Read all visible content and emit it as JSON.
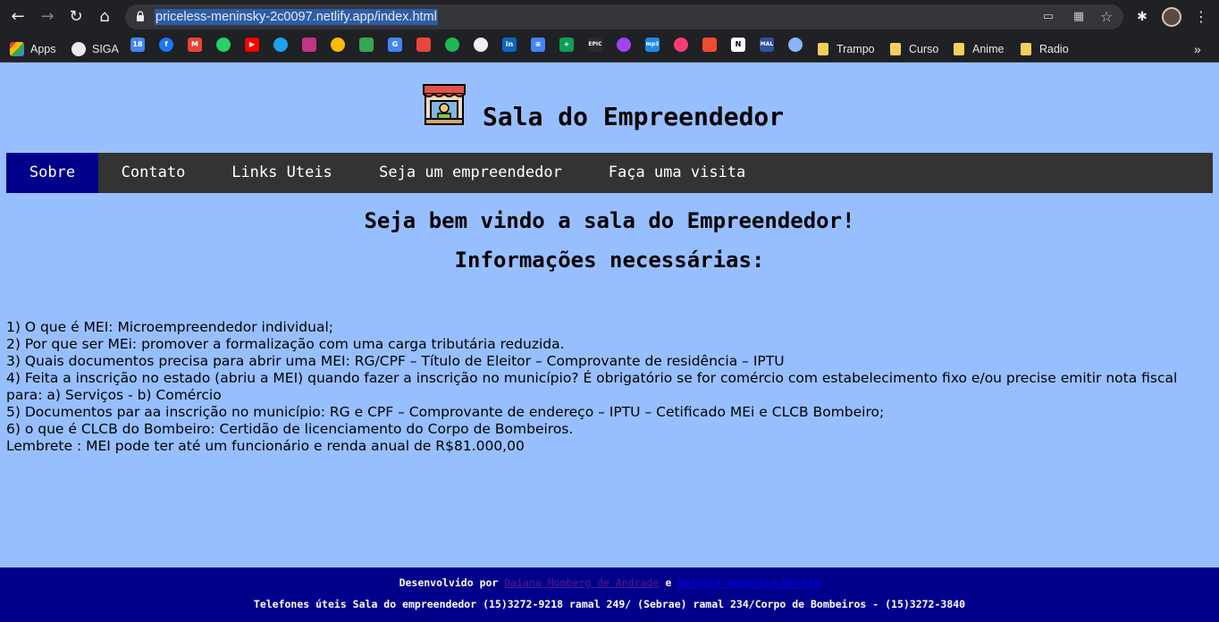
{
  "browser": {
    "url": "priceless-meninsky-2c0097.netlify.app/index.html",
    "bookmarks": [
      {
        "label": "Apps"
      },
      {
        "label": "SIGA"
      },
      {
        "label": "Trampo"
      },
      {
        "label": "Curso"
      },
      {
        "label": "Anime"
      },
      {
        "label": "Radio"
      }
    ],
    "favicons": [
      "calendar-icon",
      "facebook-icon",
      "gmail-icon",
      "whatsapp-icon",
      "youtube-icon",
      "twitter-icon",
      "instagram-icon",
      "photos-icon",
      "drive-icon",
      "translate-icon",
      "calendar-alt-icon",
      "spotify-icon",
      "github-icon",
      "linkedin-icon",
      "docs-icon",
      "sheets-icon",
      "epic-icon",
      "podcasts-icon",
      "mp3-icon",
      "tinder-icon",
      "shop-icon",
      "notion-icon",
      "mal-icon",
      "edge-icon"
    ]
  },
  "site": {
    "title": "Sala do Empreendedor",
    "menu": [
      "Sobre",
      "Contato",
      "Links Uteis",
      "Seja um empreendedor",
      "Faça uma visita"
    ],
    "welcome": "Seja bem vindo a sala do Empreendedor!",
    "subtitle": "Informações necessárias:",
    "info_lines": [
      "1) O que é MEI: Microempreendedor individual;",
      "2) Por que ser MEi: promover a formalização com uma carga tributária reduzida.",
      "3) Quais documentos precisa para abrir uma MEI: RG/CPF – Título de Eleitor – Comprovante de residência – IPTU",
      "4) Feita a inscrição no estado (abriu a MEI) quando fazer a inscrição no município? É obrigatório se for comércio com estabelecimento fixo e/ou precise emitir nota fiscal para: a) Serviços - b) Comércio",
      "5) Documentos par aa inscrição no município: RG e CPF – Comprovante de endereço – IPTU – Cetificado MEi e CLCB Bombeiro;",
      "6) o que é CLCB do Bombeiro: Certidão de licenciamento do Corpo de Bombeiros.",
      "Lembrete : MEI pode ter até um funcionário e renda anual de R$81.000,00"
    ],
    "footer": {
      "prefix": "Desenvolvido por",
      "author1": "Daiana Momberg de Andrade",
      "and": "e",
      "author2": "Rafaela Venancio Murato",
      "phones": "Telefones úteis Sala do empreendedor (15)3272-9218 ramal 249/ (Sebrae) ramal 234/Corpo de Bombeiros - (15)3272-3840"
    }
  }
}
